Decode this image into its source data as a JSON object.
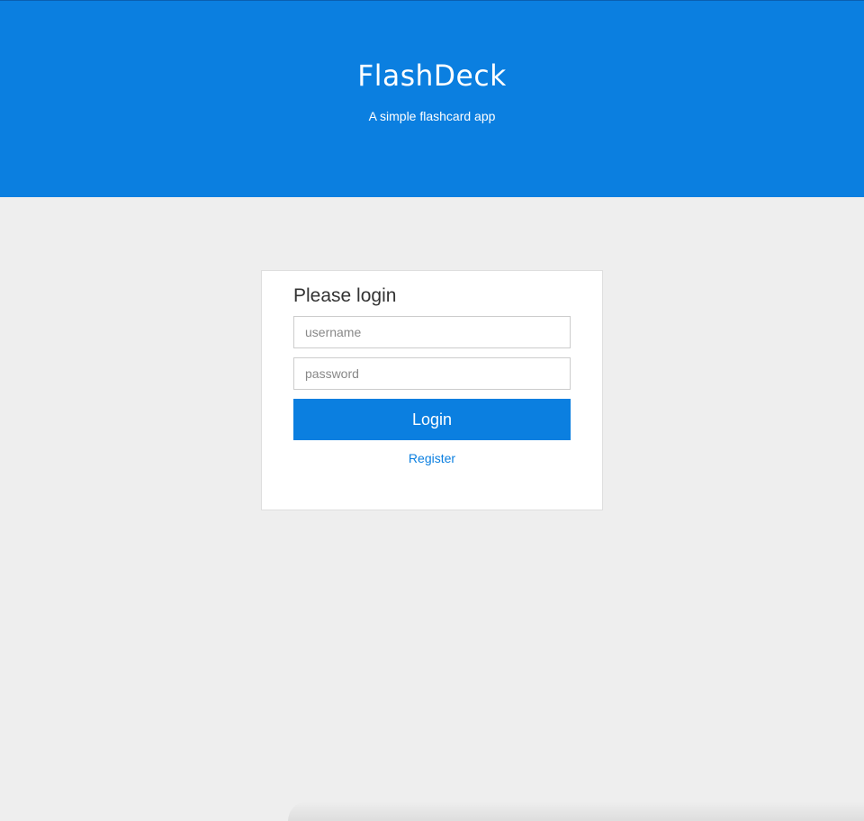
{
  "header": {
    "brand": "FlashDeck",
    "tagline": "A simple flashcard app"
  },
  "login": {
    "title": "Please login",
    "username_placeholder": "username",
    "username_value": "",
    "password_placeholder": "password",
    "password_value": "",
    "login_label": "Login",
    "register_label": "Register"
  },
  "colors": {
    "brand": "#0b7fe0",
    "background": "#eeeeee",
    "card": "#ffffff"
  }
}
